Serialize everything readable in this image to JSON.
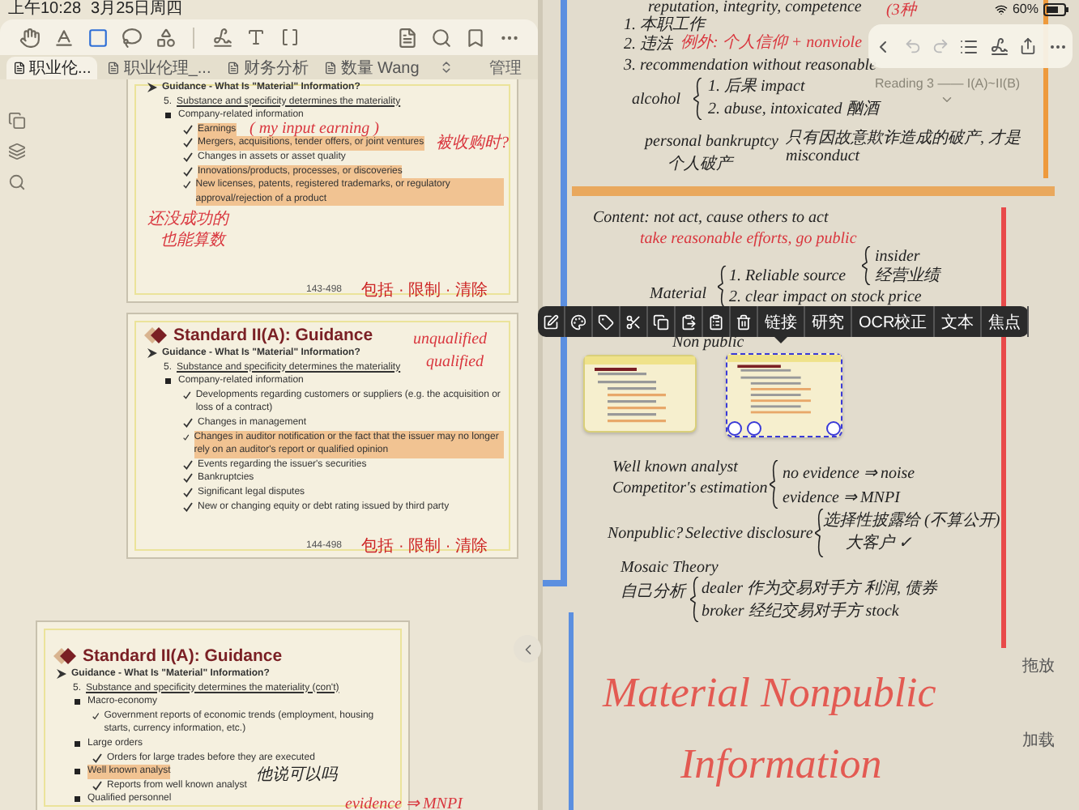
{
  "status_bar": {
    "time": "上午10:28",
    "date": "3月25日周四",
    "battery": "60%"
  },
  "left_tools": [
    {
      "selected": false
    },
    {
      "selected": false
    },
    {
      "selected": true
    },
    {
      "selected": false
    },
    {
      "selected": false
    }
  ],
  "tabs": [
    {
      "label": "职业伦...",
      "selected": true
    },
    {
      "label": "职业伦理_...",
      "selected": false
    },
    {
      "label": "财务分析",
      "selected": false
    },
    {
      "label": "数量 Wang",
      "selected": false
    }
  ],
  "manage_button": "管理",
  "pages": [
    {
      "lines": [
        {
          "kind": "guidance",
          "text": "Guidance - What Is \"Material\" Information?",
          "highlight": false
        },
        {
          "kind": "sub",
          "number": "5.",
          "text": "Substance and specificity determines the materiality",
          "highlight": false
        },
        {
          "kind": "bullet",
          "text": "Company-related information",
          "highlight": false
        },
        {
          "kind": "check",
          "text": "Earnings",
          "highlight": true
        },
        {
          "kind": "check",
          "text": "Mergers, acquisitions, tender offers, or joint ventures",
          "highlight": true
        },
        {
          "kind": "check",
          "text": "Changes in assets or asset quality",
          "highlight": false
        },
        {
          "kind": "check",
          "text": "Innovations/products, processes, or discoveries",
          "highlight": true
        },
        {
          "kind": "check",
          "text": "New licenses, patents, registered trademarks, or regulatory approval/rejection of a product",
          "highlight": true
        }
      ],
      "annotations": [
        {
          "text": "( my input earning )",
          "color": "#d9363e"
        },
        {
          "text": "被收购时?",
          "color": "#d9363e"
        },
        {
          "text": "还没成功的",
          "color": "#d9363e"
        },
        {
          "text": "也能算数",
          "color": "#d9363e"
        }
      ],
      "page_number": "143-498",
      "footer_note": "包括 · 限制 · 清除"
    },
    {
      "title": "Standard II(A): Guidance",
      "lines": [
        {
          "kind": "guidance",
          "text": "Guidance - What Is \"Material\" Information?",
          "highlight": false
        },
        {
          "kind": "sub",
          "number": "5.",
          "text": "Substance and specificity determines the materiality",
          "highlight": false
        },
        {
          "kind": "bullet",
          "text": "Company-related information",
          "highlight": false
        },
        {
          "kind": "check",
          "text": "Developments regarding customers or suppliers (e.g. the acquisition or loss of a contract)",
          "highlight": false
        },
        {
          "kind": "check",
          "text": "Changes in management",
          "highlight": false
        },
        {
          "kind": "check",
          "text": "Changes in auditor notification or the fact that the issuer may no longer rely on an auditor's report or qualified opinion",
          "highlight": true
        },
        {
          "kind": "check",
          "text": "Events regarding the issuer's securities",
          "highlight": false
        },
        {
          "kind": "check",
          "text": "Bankruptcies",
          "highlight": false
        },
        {
          "kind": "check",
          "text": "Significant legal disputes",
          "highlight": false
        },
        {
          "kind": "check",
          "text": "New or changing equity or debt rating issued by third party",
          "highlight": false
        }
      ],
      "annotations": [
        {
          "text": "unqualified",
          "color": "#d9363e"
        },
        {
          "text": "qualified",
          "color": "#d9363e"
        }
      ],
      "page_number": "144-498",
      "footer_note": "包括 · 限制 · 清除"
    },
    {
      "title": "Standard II(A): Guidance",
      "lines": [
        {
          "kind": "guidance",
          "text": "Guidance - What Is \"Material\" Information?",
          "highlight": false
        },
        {
          "kind": "sub",
          "number": "5.",
          "text": "Substance and specificity determines the materiality (con't)",
          "highlight": false
        },
        {
          "kind": "bullet",
          "text": "Macro-economy",
          "highlight": false
        },
        {
          "kind": "check",
          "text": "Government reports of economic trends (employment, housing starts, currency information, etc.)",
          "highlight": false
        },
        {
          "kind": "bullet",
          "text": "Large orders",
          "highlight": false
        },
        {
          "kind": "check",
          "text": "Orders for large trades before they are executed",
          "highlight": false
        },
        {
          "kind": "bullet",
          "text": "Well known analyst",
          "highlight": true
        },
        {
          "kind": "check",
          "text": "Reports from well known analyst",
          "highlight": false
        },
        {
          "kind": "bullet",
          "text": "Qualified personnel",
          "highlight": false
        }
      ],
      "annotations": [
        {
          "text": "他说可以吗",
          "color": "#222222"
        },
        {
          "text": "evidence ⇒ MNPI",
          "color": "#d9363e"
        }
      ]
    }
  ],
  "canvas": {
    "breadcrumb": "Reading 3 —— I(A)~II(B)",
    "notes": [
      {
        "kind": "note",
        "text": "reputation, integrity, competence",
        "color": "#222222"
      },
      {
        "kind": "note",
        "text": "(3种",
        "color": "#d9363e"
      },
      {
        "kind": "note",
        "text": "1. 本职工作",
        "color": "#222222"
      },
      {
        "kind": "note",
        "text": "2. 违法",
        "color": "#222222"
      },
      {
        "kind": "note",
        "text": "例外: 个人信仰 + nonviole",
        "color": "#d9363e"
      },
      {
        "kind": "note",
        "text": "3. recommendation without reasonable",
        "color": "#222222"
      },
      {
        "kind": "note",
        "text": "1. 后果 impact",
        "color": "#222222"
      },
      {
        "kind": "note",
        "text": "alcohol",
        "color": "#222222"
      },
      {
        "kind": "note",
        "text": "2. abuse, intoxicated 酗酒",
        "color": "#222222"
      },
      {
        "kind": "note",
        "text": "personal bankruptcy",
        "color": "#222222"
      },
      {
        "kind": "note",
        "text": "个人破产",
        "color": "#222222"
      },
      {
        "kind": "note",
        "text": "只有因故意欺诈造成的破产, 才是misconduct",
        "color": "#222222"
      },
      {
        "kind": "note",
        "text": "Content: not act, cause others to act",
        "color": "#222222"
      },
      {
        "kind": "note",
        "text": "take reasonable efforts, go public",
        "color": "#d9363e"
      },
      {
        "kind": "note",
        "text": "insider",
        "color": "#222222"
      },
      {
        "kind": "note",
        "text": "经营业绩",
        "color": "#222222"
      },
      {
        "kind": "note",
        "text": "1. Reliable source",
        "color": "#222222"
      },
      {
        "kind": "note",
        "text": "Material",
        "color": "#222222"
      },
      {
        "kind": "note",
        "text": "2. clear impact on stock price",
        "color": "#222222"
      },
      {
        "kind": "note",
        "text": "Non public",
        "color": "#222222"
      },
      {
        "kind": "note",
        "text": "Well known analyst",
        "color": "#222222"
      },
      {
        "kind": "note",
        "text": "Competitor's estimation",
        "color": "#222222"
      },
      {
        "kind": "note",
        "text": "no evidence ⇒ noise",
        "color": "#222222"
      },
      {
        "kind": "note",
        "text": "evidence ⇒ MNPI",
        "color": "#222222"
      },
      {
        "kind": "note",
        "text": "Nonpublic?",
        "color": "#222222"
      },
      {
        "kind": "note",
        "text": "Selective disclosure",
        "color": "#222222"
      },
      {
        "kind": "note",
        "text": "选择性披露给 (不算公开)",
        "color": "#222222"
      },
      {
        "kind": "note",
        "text": "大客户 ✓",
        "color": "#222222"
      },
      {
        "kind": "note",
        "text": "Mosaic Theory",
        "color": "#222222"
      },
      {
        "kind": "note",
        "text": "自己分析",
        "color": "#222222"
      },
      {
        "kind": "note",
        "text": "dealer 作为交易对手方 利润, 债券",
        "color": "#222222"
      },
      {
        "kind": "note",
        "text": "broker 经纪交易对手方 stock",
        "color": "#222222"
      },
      {
        "kind": "heading",
        "text": "Material Nonpublic",
        "color": "#e35a52"
      },
      {
        "kind": "heading",
        "text": "Information",
        "color": "#e35a52"
      }
    ],
    "thumbnails": [
      {
        "selected": false
      },
      {
        "selected": true
      }
    ]
  },
  "popup_actions": [
    "链接",
    "研究",
    "OCR校正",
    "文本",
    "焦点"
  ],
  "side_buttons": [
    "拖放",
    "加载"
  ]
}
